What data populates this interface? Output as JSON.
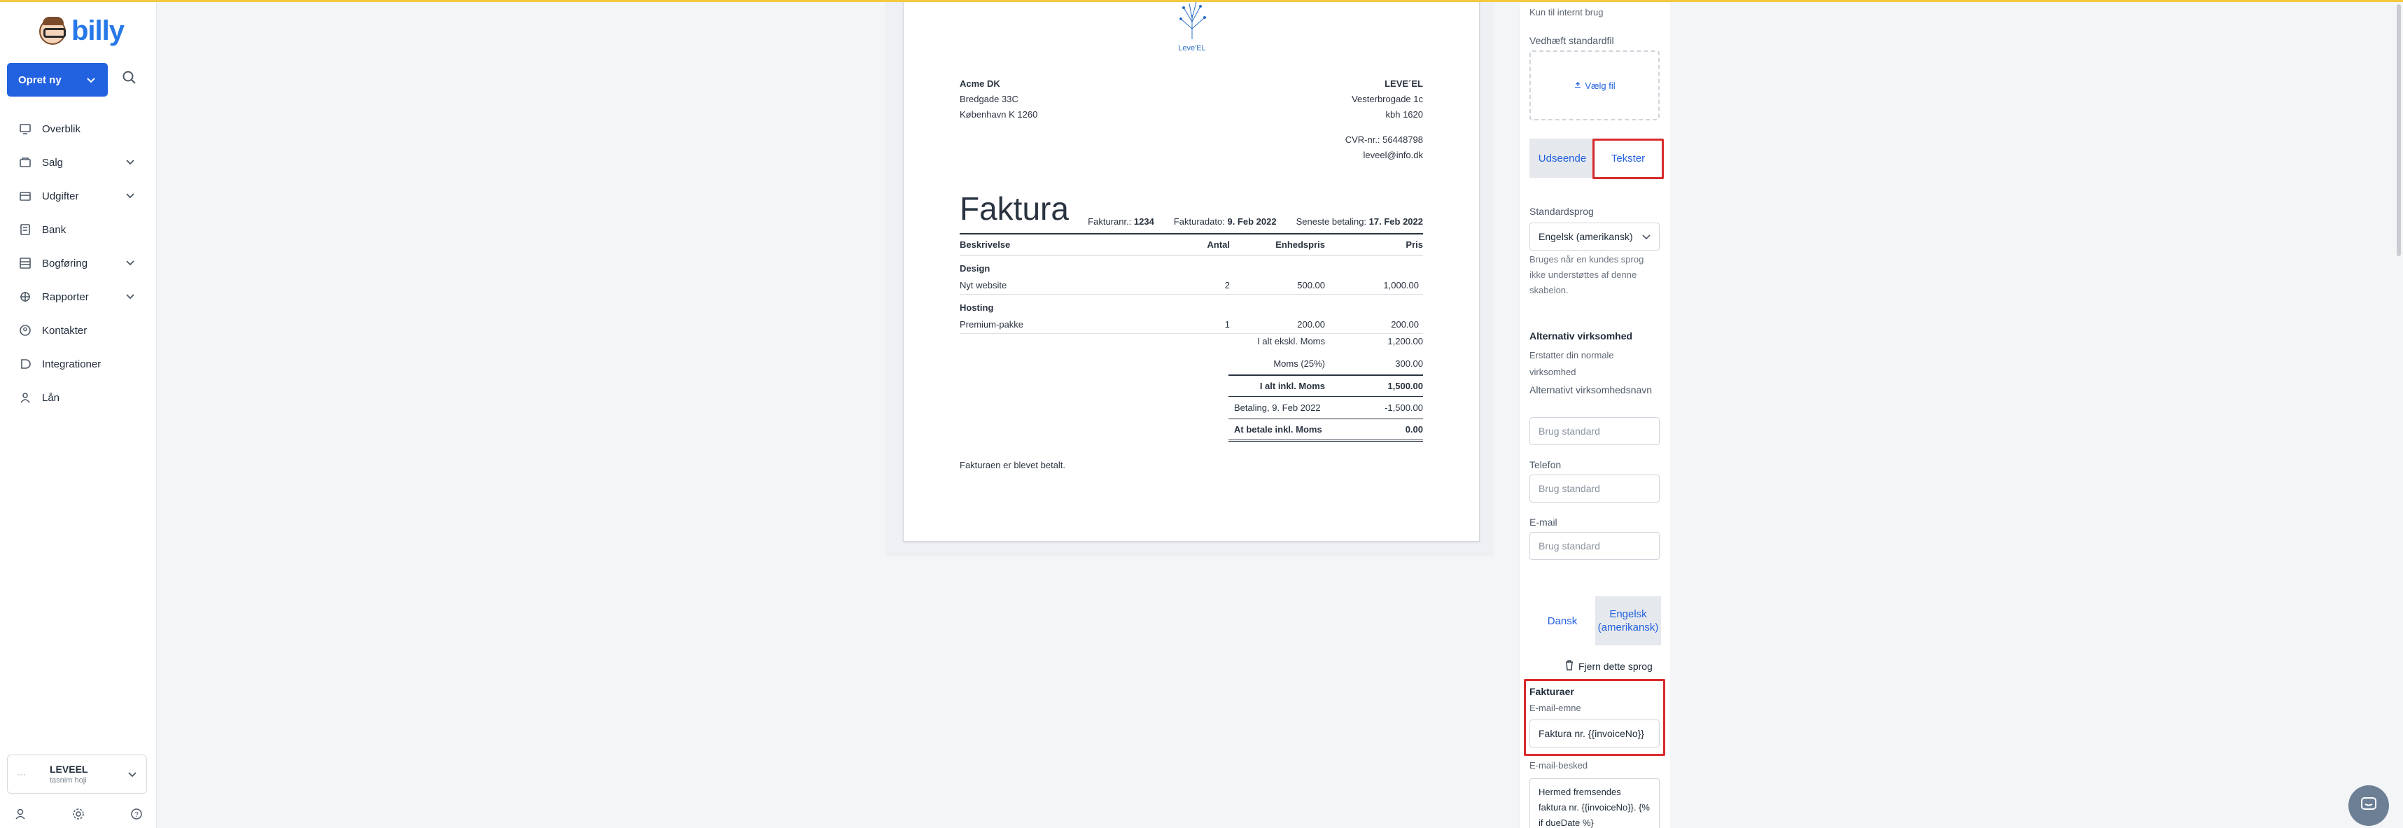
{
  "app": {
    "logo_text": "billy"
  },
  "sidebar": {
    "create_label": "Opret ny",
    "items": [
      {
        "label": "Overblik",
        "icon": "dashboard-icon",
        "has_submenu": false
      },
      {
        "label": "Salg",
        "icon": "sales-icon",
        "has_submenu": true
      },
      {
        "label": "Udgifter",
        "icon": "expenses-icon",
        "has_submenu": true
      },
      {
        "label": "Bank",
        "icon": "bank-icon",
        "has_submenu": false
      },
      {
        "label": "Bogføring",
        "icon": "bookkeeping-icon",
        "has_submenu": true
      },
      {
        "label": "Rapporter",
        "icon": "reports-icon",
        "has_submenu": true
      },
      {
        "label": "Kontakter",
        "icon": "contacts-icon",
        "has_submenu": false
      },
      {
        "label": "Integrationer",
        "icon": "integrations-icon",
        "has_submenu": false
      },
      {
        "label": "Lån",
        "icon": "loan-icon",
        "has_submenu": false
      }
    ],
    "org": {
      "name": "LEVEEL",
      "user": "tasnim hoji"
    }
  },
  "invoice": {
    "logo_caption": "Leve'EL",
    "sender": {
      "name": "Acme DK",
      "address1": "Bredgade 33C",
      "address2": "København K 1260"
    },
    "recipient": {
      "name": "LEVE´EL",
      "address1": "Vesterbrogade 1c",
      "address2": "kbh 1620",
      "cvr": "CVR-nr.: 56448798",
      "email": "leveel@info.dk"
    },
    "title": "Faktura",
    "meta": {
      "number_label": "Fakturanr.:",
      "number": "1234",
      "date_label": "Fakturadato:",
      "date": "9. Feb 2022",
      "due_label": "Seneste betaling:",
      "due": "17. Feb 2022"
    },
    "columns": [
      "Beskrivelse",
      "Antal",
      "Enhedspris",
      "Pris"
    ],
    "groups": [
      {
        "name": "Design",
        "lines": [
          {
            "desc": "Nyt website",
            "qty": "2",
            "unit": "500.00",
            "price": "1,000.00"
          }
        ]
      },
      {
        "name": "Hosting",
        "lines": [
          {
            "desc": "Premium-pakke",
            "qty": "1",
            "unit": "200.00",
            "price": "200.00"
          }
        ]
      }
    ],
    "totals": {
      "excl_label": "I alt ekskl. Moms",
      "excl": "1,200.00",
      "vat_label": "Moms (25%)",
      "vat": "300.00",
      "incl_label": "I alt inkl. Moms",
      "incl": "1,500.00",
      "payment_label": "Betaling, 9. Feb 2022",
      "payment": "-1,500.00",
      "due_label": "At betale inkl. Moms",
      "due": "0.00"
    },
    "paid_note": "Fakturaen er blevet betalt."
  },
  "panel": {
    "internal_note": "Kun til internt brug",
    "attach_label": "Vedhæft standardfil",
    "choose_file": "Vælg fil",
    "tab_appearance": "Udseende",
    "tab_texts": "Tekster",
    "default_lang_label": "Standardsprog",
    "default_lang_value": "Engelsk (amerikansk)",
    "default_lang_help": "Bruges når en kundes sprog ikke understøttes af denne skabelon.",
    "alt_company_title": "Alternativ virksomhed",
    "alt_company_help": "Erstatter din normale virksomhed",
    "alt_name_label": "Alternativt virksomhedsnavn",
    "alt_name_placeholder": "Brug standard",
    "phone_label": "Telefon",
    "phone_placeholder": "Brug standard",
    "email_label": "E-mail",
    "email_placeholder": "Brug standard",
    "lang_tab_danish": "Dansk",
    "lang_tab_english": "Engelsk (amerikansk)",
    "remove_lang": "Fjern dette sprog",
    "invoices_title": "Fakturaer",
    "email_subject_label": "E-mail-emne",
    "email_subject_value": "Faktura nr. {{invoiceNo}}",
    "email_body_label": "E-mail-besked",
    "email_body_value": "Hermed fremsendes faktura nr. {{invoiceNo}}. {% if dueDate %}"
  },
  "colors": {
    "accent": "#2261e0",
    "highlight": "#d92b2b",
    "top_accent": "#f3c93f"
  }
}
